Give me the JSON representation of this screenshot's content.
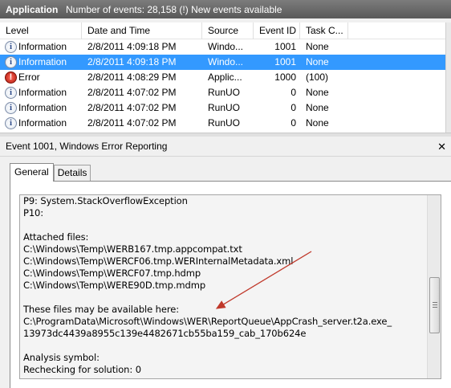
{
  "header": {
    "title": "Application",
    "status": "Number of events: 28,158 (!) New events available"
  },
  "grid": {
    "columns": [
      "Level",
      "Date and Time",
      "Source",
      "Event ID",
      "Task C..."
    ],
    "rows": [
      {
        "level": "Information",
        "icon": "info-icon",
        "date": "2/8/2011 4:09:18 PM",
        "source": "Windo...",
        "event_id": "1001",
        "task": "None"
      },
      {
        "level": "Information",
        "icon": "info-icon",
        "date": "2/8/2011 4:09:18 PM",
        "source": "Windo...",
        "event_id": "1001",
        "task": "None"
      },
      {
        "level": "Error",
        "icon": "error-icon",
        "date": "2/8/2011 4:08:29 PM",
        "source": "Applic...",
        "event_id": "1000",
        "task": "(100)"
      },
      {
        "level": "Information",
        "icon": "info-icon",
        "date": "2/8/2011 4:07:02 PM",
        "source": "RunUO",
        "event_id": "0",
        "task": "None"
      },
      {
        "level": "Information",
        "icon": "info-icon",
        "date": "2/8/2011 4:07:02 PM",
        "source": "RunUO",
        "event_id": "0",
        "task": "None"
      },
      {
        "level": "Information",
        "icon": "info-icon",
        "date": "2/8/2011 4:07:02 PM",
        "source": "RunUO",
        "event_id": "0",
        "task": "None"
      }
    ]
  },
  "details": {
    "title": "Event 1001, Windows Error Reporting",
    "close_glyph": "✕",
    "tabs": [
      "General",
      "Details"
    ],
    "lines": [
      "P9: System.StackOverflowException",
      "P10:",
      "",
      "Attached files:",
      "C:\\Windows\\Temp\\WERB167.tmp.appcompat.txt",
      "C:\\Windows\\Temp\\WERCF06.tmp.WERInternalMetadata.xml",
      "C:\\Windows\\Temp\\WERCF07.tmp.hdmp",
      "C:\\Windows\\Temp\\WERE90D.tmp.mdmp",
      "",
      "These files may be available here:",
      "C:\\ProgramData\\Microsoft\\Windows\\WER\\ReportQueue\\AppCrash_server.t2a.exe_",
      "13973dc4439a8955c139e4482671cb55ba159_cab_170b624e",
      "",
      "Analysis symbol:",
      "Rechecking for solution: 0"
    ]
  },
  "colors": {
    "selection": "#3399ff",
    "header_bg": "#6a6a6a",
    "arrow": "#c0392b"
  }
}
